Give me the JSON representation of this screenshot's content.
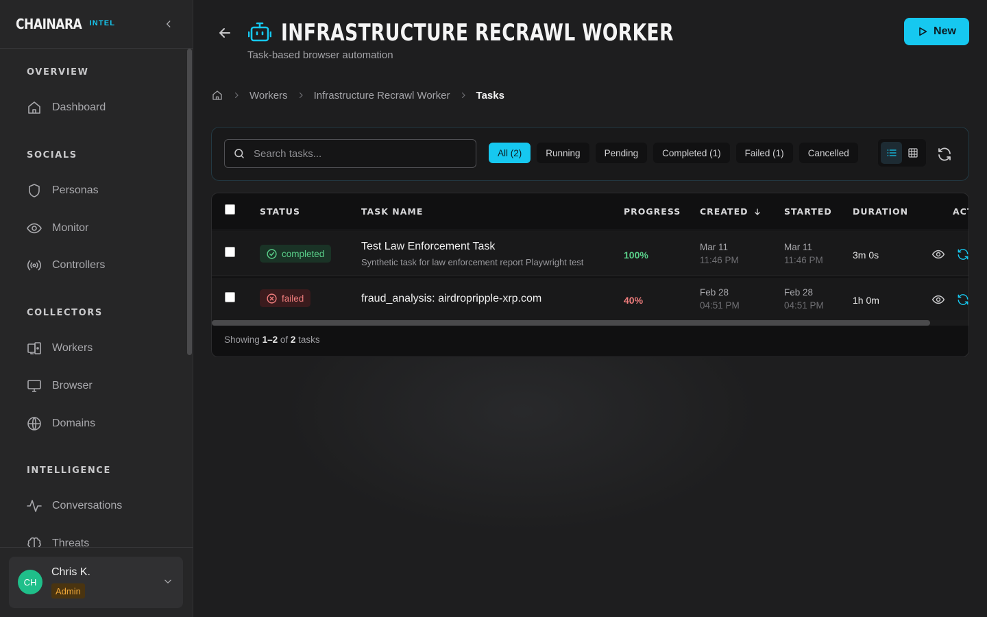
{
  "brand": {
    "name": "CHAINARA",
    "tag": "INTEL"
  },
  "nav": {
    "sections": [
      {
        "title": "OVERVIEW",
        "items": [
          {
            "label": "Dashboard",
            "icon": "home-icon"
          }
        ]
      },
      {
        "title": "SOCIALS",
        "items": [
          {
            "label": "Personas",
            "icon": "shield-icon"
          },
          {
            "label": "Monitor",
            "icon": "eye-icon"
          },
          {
            "label": "Controllers",
            "icon": "broadcast-icon"
          }
        ]
      },
      {
        "title": "COLLECTORS",
        "items": [
          {
            "label": "Workers",
            "icon": "devices-icon"
          },
          {
            "label": "Browser",
            "icon": "monitor-icon"
          },
          {
            "label": "Domains",
            "icon": "globe-icon"
          }
        ]
      },
      {
        "title": "INTELLIGENCE",
        "items": [
          {
            "label": "Conversations",
            "icon": "activity-icon"
          },
          {
            "label": "Threats",
            "icon": "brain-icon"
          }
        ]
      }
    ]
  },
  "user": {
    "initials": "CH",
    "name": "Chris K.",
    "role": "Admin"
  },
  "header": {
    "title": "INFRASTRUCTURE RECRAWL WORKER",
    "subtitle": "Task-based browser automation",
    "new_label": "New"
  },
  "breadcrumb": [
    "Workers",
    "Infrastructure Recrawl Worker",
    "Tasks"
  ],
  "toolbar": {
    "search_placeholder": "Search tasks...",
    "filters": [
      "All (2)",
      "Running",
      "Pending",
      "Completed (1)",
      "Failed (1)",
      "Cancelled"
    ],
    "active_filter": 0
  },
  "table": {
    "columns": [
      "STATUS",
      "TASK NAME",
      "PROGRESS",
      "CREATED",
      "STARTED",
      "DURATION",
      "ACT"
    ],
    "rows": [
      {
        "status": "completed",
        "name": "Test Law Enforcement Task",
        "description": "Synthetic task for law enforcement report Playwright test",
        "progress": "100%",
        "created_date": "Mar 11",
        "created_time": "11:46 PM",
        "started_date": "Mar 11",
        "started_time": "11:46 PM",
        "duration": "3m 0s"
      },
      {
        "status": "failed",
        "name": "fraud_analysis: airdropripple-xrp.com",
        "description": "",
        "progress": "40%",
        "created_date": "Feb 28",
        "created_time": "04:51 PM",
        "started_date": "Feb 28",
        "started_time": "04:51 PM",
        "duration": "1h 0m"
      }
    ],
    "footer": {
      "prefix": "Showing",
      "range": "1–2",
      "of": "of",
      "total": "2",
      "suffix": "tasks"
    }
  },
  "colors": {
    "accent": "#16c8f0",
    "success": "#5ad08a",
    "danger": "#f07d7d",
    "admin": "#f2a93a"
  }
}
